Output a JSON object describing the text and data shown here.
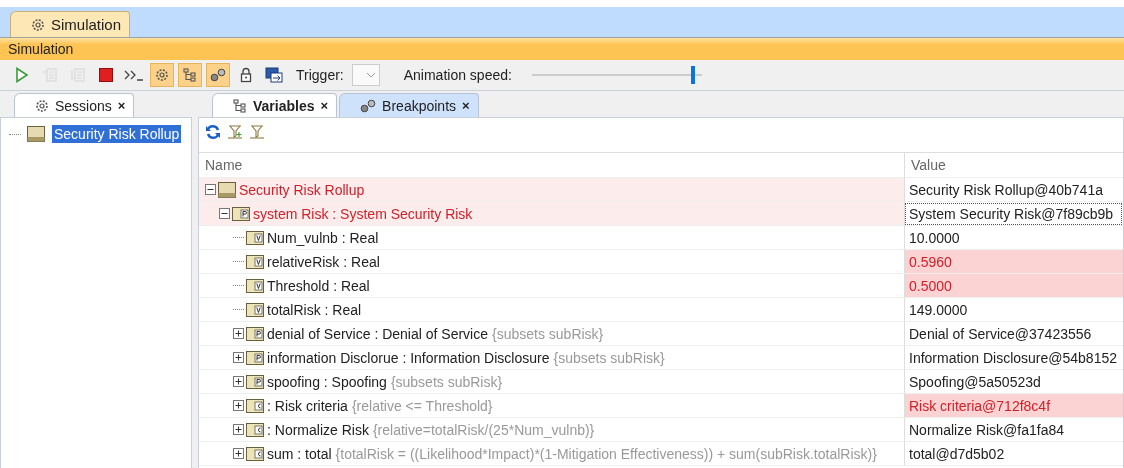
{
  "window_tab": {
    "label": "Simulation",
    "selected": true
  },
  "panel_title": "Simulation",
  "toolbar": {
    "buttons": [
      {
        "kind": "run",
        "disabled": false
      },
      {
        "kind": "step-into",
        "disabled": true
      },
      {
        "kind": "step-over",
        "disabled": true
      },
      {
        "kind": "stop",
        "disabled": false
      },
      {
        "kind": "console",
        "disabled": false
      },
      {
        "kind": "toggle-gear",
        "on": true
      },
      {
        "kind": "toggle-tree",
        "on": true
      },
      {
        "kind": "toggle-breakpoints",
        "on": true
      },
      {
        "kind": "lock",
        "disabled": false
      },
      {
        "kind": "export",
        "disabled": false
      }
    ],
    "trigger_label": "Trigger:",
    "speed_label": "Animation speed:",
    "speed": {
      "level": 0.95
    }
  },
  "left_tabs": [
    {
      "label": "Sessions",
      "close": "×",
      "selected": true
    }
  ],
  "sessions": [
    {
      "label": "Security Risk Rollup",
      "selected": true
    }
  ],
  "right_tabs": [
    {
      "kind": "tree",
      "label": "Variables",
      "close": "×",
      "selected": true
    },
    {
      "kind": "breakpoints",
      "label": "Breakpoints",
      "close": "×",
      "selected": false
    }
  ],
  "variables_toolbar": [
    {
      "kind": "refresh"
    },
    {
      "kind": "filter-add"
    },
    {
      "kind": "filter"
    }
  ],
  "table": {
    "columns": [
      "Name",
      "Value"
    ],
    "rows": [
      {
        "kind": "block",
        "name": "Security Risk Rollup",
        "value": "Security Risk Rollup@40b741a",
        "expanded": true,
        "name_alert": true,
        "value_alert": false,
        "children": [
          {
            "kind": "part",
            "name": "system Risk : System Security Risk",
            "value": "System Security Risk@7f89cb9b",
            "expanded": true,
            "name_alert": true,
            "value_alert": false,
            "focused": true,
            "children": [
              {
                "kind": "value",
                "name": "Num_vulnb : Real",
                "value": "10.0000",
                "name_alert": false,
                "value_alert": false
              },
              {
                "kind": "value",
                "name": "relativeRisk : Real",
                "value": "0.5960",
                "name_alert": false,
                "value_alert": true
              },
              {
                "kind": "value",
                "name": "Threshold : Real",
                "value": "0.5000",
                "name_alert": false,
                "value_alert": true
              },
              {
                "kind": "value",
                "name": "totalRisk : Real",
                "value": "149.0000",
                "name_alert": false,
                "value_alert": false
              },
              {
                "kind": "part",
                "name": "denial of Service : Denial of Service",
                "note": "{subsets subRisk}",
                "value": "Denial of Service@37423556",
                "expanded": false,
                "name_alert": false,
                "value_alert": false
              },
              {
                "kind": "part",
                "name": "information Disclorue : Information Disclosure",
                "note": "{subsets subRisk}",
                "value": "Information Disclosure@54b8152",
                "expanded": false,
                "name_alert": false,
                "value_alert": false
              },
              {
                "kind": "part",
                "name": "spoofing : Spoofing",
                "note": "{subsets subRisk}",
                "value": "Spoofing@5a50523d",
                "expanded": false,
                "name_alert": false,
                "value_alert": false
              },
              {
                "kind": "constraint",
                "name": " : Risk criteria",
                "note": "{relative <= Threshold}",
                "value": "Risk criteria@712f8c4f",
                "expanded": false,
                "name_alert": false,
                "value_alert": true
              },
              {
                "kind": "constraint",
                "name": " : Normalize Risk",
                "note": "{relative=totalRisk/(25*Num_vulnb)}",
                "value": "Normalize Risk@fa1fa84",
                "expanded": false,
                "name_alert": false,
                "value_alert": false
              },
              {
                "kind": "constraint",
                "name": "sum : total",
                "note": "{totalRisk = ((Likelihood*Impact)*(1-Mitigation Effectiveness)) + sum(subRisk.totalRisk)}",
                "value": "total@d7d5b02",
                "expanded": false,
                "name_alert": false,
                "value_alert": false
              }
            ]
          }
        ]
      }
    ]
  }
}
